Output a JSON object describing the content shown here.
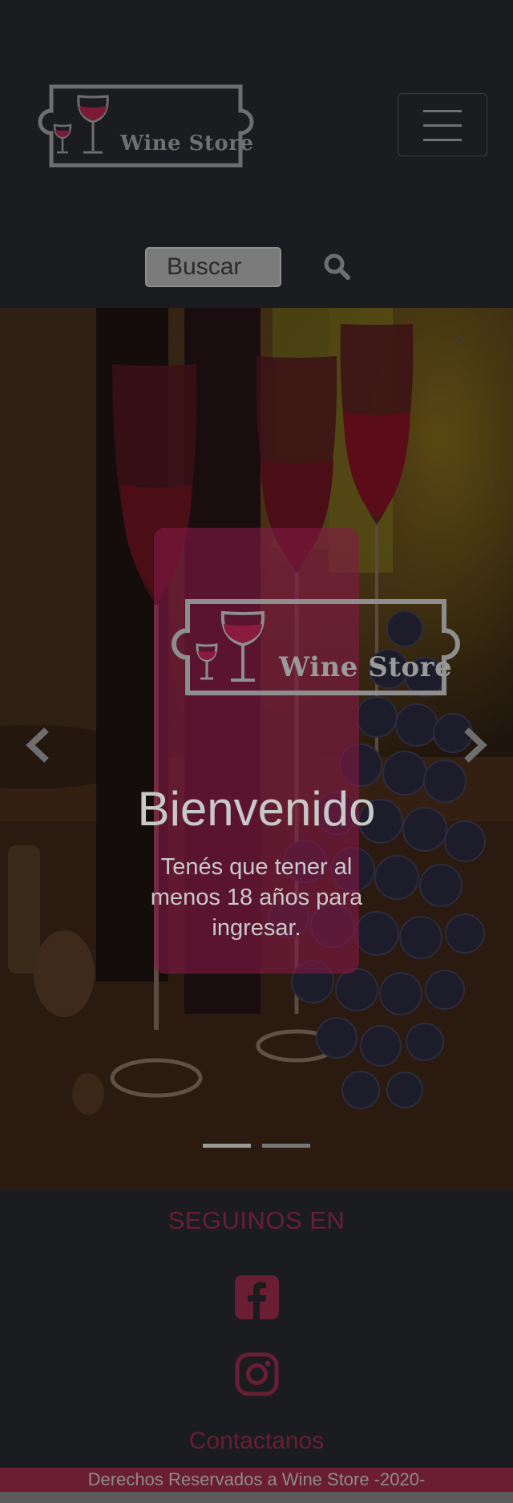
{
  "header": {
    "logo_text": "Wine Store",
    "menu_toggle_icon": "hamburger-icon"
  },
  "search": {
    "placeholder": "Buscar",
    "button_icon": "search-icon"
  },
  "carousel": {
    "close_label": "×",
    "prev_icon": "chevron-left-icon",
    "next_icon": "chevron-right-icon",
    "caption_logo_text": "Wine Store",
    "title": "Bienvenido",
    "text": "Tenés que tener al menos 18 años para ingresar.",
    "slides_count": 2,
    "active_slide": 1
  },
  "social": {
    "title": "SEGUINOS EN",
    "icons": [
      "facebook-icon",
      "instagram-icon"
    ],
    "contact_label": "Contactanos"
  },
  "footer": {
    "text": "Derechos Reservados a Wine Store -2020-"
  },
  "colors": {
    "background": "#1b1c20",
    "brand_wine": "#831a44",
    "social_color": "#6a1e34",
    "footer_bg": "#6b1d32"
  }
}
